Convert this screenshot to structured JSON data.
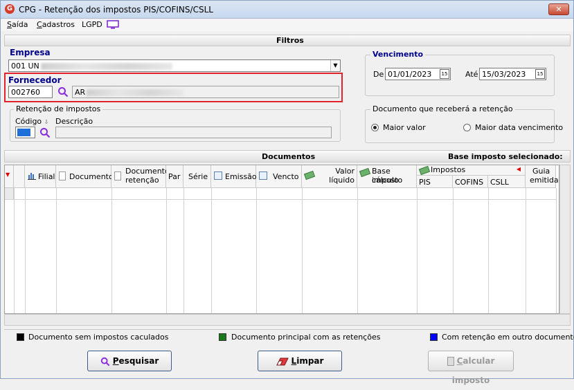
{
  "window": {
    "title": "CPG - Retenção dos impostos PIS/COFINS/CSLL",
    "icon_letter": "G",
    "close_glyph": "✕"
  },
  "menu": {
    "items": [
      {
        "ul": "S",
        "rest": "aída"
      },
      {
        "ul": "C",
        "rest": "adastros"
      },
      {
        "ul": "",
        "rest": "LGPD"
      }
    ]
  },
  "filtros": {
    "section_title": "Filtros",
    "empresa": {
      "label": "Empresa",
      "value": "001 UN"
    },
    "fornecedor": {
      "label": "Fornecedor",
      "code": "002760",
      "name": "AR"
    },
    "retencao": {
      "group_title": "Retenção de impostos",
      "codigo_label": "Código",
      "descricao_label": "Descrição",
      "codigo_value": "",
      "descricao_value": ""
    },
    "vencimento": {
      "group_title": "Vencimento",
      "de_label": "De",
      "de_value": "01/01/2023",
      "ate_label": "Até",
      "ate_value": "15/03/2023"
    },
    "documento": {
      "group_title": "Documento que receberá a retenção",
      "options": [
        "Maior valor",
        "Maior data vencimento"
      ],
      "selected": "Maior valor"
    }
  },
  "documentos": {
    "section_title": "Documentos",
    "base_title": "Base imposto selecionado:",
    "columns": {
      "filial": "Filial",
      "documento": "Documento",
      "documento_retencao_1": "Documento",
      "documento_retencao_2": "retenção",
      "par": "Par",
      "serie": "Série",
      "emissao": "Emissão",
      "vencto": "Vencto",
      "valor_liquido_1": "Valor",
      "valor_liquido_2": "líquido",
      "base_calculo_1": "Base cálculo",
      "base_calculo_2": "imposto",
      "impostos": "Impostos",
      "pis": "PIS",
      "cofins": "COFINS",
      "csll": "CSLL",
      "guia_1": "Guia",
      "guia_2": "emitida"
    },
    "rows": []
  },
  "legend": [
    {
      "label": "Documento sem impostos caculados",
      "color": "#000000"
    },
    {
      "label": "Documento principal com as retenções",
      "color": "#1a7a1a"
    },
    {
      "label": "Com retenção em outro documento",
      "color": "#0000ff"
    }
  ],
  "buttons": {
    "pesquisar": {
      "ul": "P",
      "rest": "esquisar"
    },
    "limpar": {
      "ul": "L",
      "rest": "impar"
    },
    "calcular": {
      "ul": "C",
      "rest": "alcular imposto"
    }
  },
  "colors": {
    "highlight": "#e3232c",
    "title_blue": "#00008b",
    "search_icon": "#8a2be2"
  }
}
